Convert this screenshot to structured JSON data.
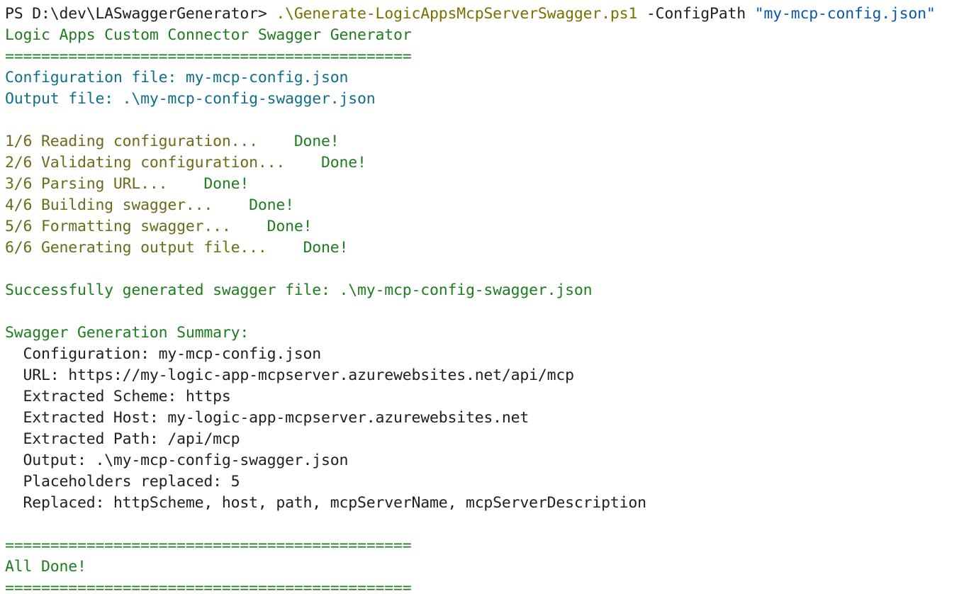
{
  "colors": {
    "background": "#ffffff",
    "default_text": "#1f1f1f",
    "prompt_command": "#7a6f00",
    "string_arg": "#0a56b0",
    "green": "#1e7d1e",
    "cyan": "#0f6f8a",
    "olive": "#6b6b1a"
  },
  "prompt": {
    "path": "PS D:\\dev\\LASwaggerGenerator> ",
    "command": ".\\Generate-LogicAppsMcpServerSwagger.ps1",
    "param": " -ConfigPath ",
    "value": "\"my-mcp-config.json\""
  },
  "header": {
    "title": "Logic Apps Custom Connector Swagger Generator",
    "separator": "=============================================",
    "config_line": "Configuration file: my-mcp-config.json",
    "output_line": "Output file: .\\my-mcp-config-swagger.json"
  },
  "steps": [
    {
      "label": "1/6 Reading configuration...    ",
      "status": "Done!"
    },
    {
      "label": "2/6 Validating configuration...    ",
      "status": "Done!"
    },
    {
      "label": "3/6 Parsing URL...    ",
      "status": "Done!"
    },
    {
      "label": "4/6 Building swagger...    ",
      "status": "Done!"
    },
    {
      "label": "5/6 Formatting swagger...    ",
      "status": "Done!"
    },
    {
      "label": "6/6 Generating output file...    ",
      "status": "Done!"
    }
  ],
  "success_line": "Successfully generated swagger file: .\\my-mcp-config-swagger.json",
  "summary": {
    "title": "Swagger Generation Summary:",
    "items": [
      "  Configuration: my-mcp-config.json",
      "  URL: https://my-logic-app-mcpserver.azurewebsites.net/api/mcp",
      "  Extracted Scheme: https",
      "  Extracted Host: my-logic-app-mcpserver.azurewebsites.net",
      "  Extracted Path: /api/mcp",
      "  Output: .\\my-mcp-config-swagger.json",
      "  Placeholders replaced: 5",
      "  Replaced: httpScheme, host, path, mcpServerName, mcpServerDescription"
    ]
  },
  "footer": {
    "separator_top": "=============================================",
    "done": "All Done!",
    "separator_bottom": "============================================="
  }
}
